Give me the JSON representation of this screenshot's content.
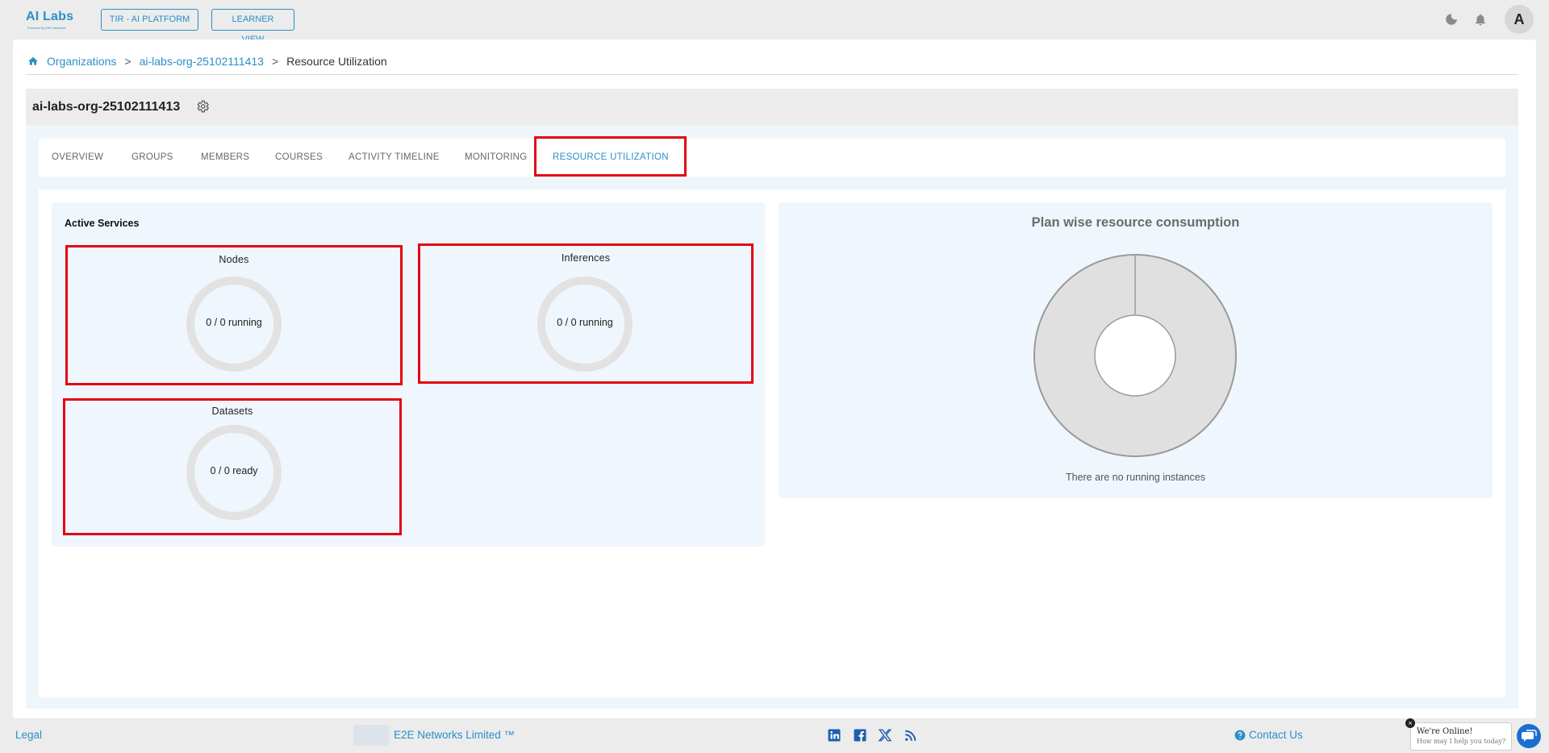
{
  "header": {
    "logo_text": "AI Labs",
    "logo_subtitle": "Powered by E2E Networks",
    "buttons": [
      "TIR - AI PLATFORM",
      "LEARNER VIEW"
    ],
    "avatar_initial": "A"
  },
  "breadcrumb": {
    "items": [
      "Organizations",
      "ai-labs-org-25102111413",
      "Resource Utilization"
    ],
    "separator": ">"
  },
  "org": {
    "title": "ai-labs-org-25102111413"
  },
  "tabs": {
    "items": [
      "OVERVIEW",
      "GROUPS",
      "MEMBERS",
      "COURSES",
      "ACTIVITY TIMELINE",
      "MONITORING",
      "RESOURCE UTILIZATION"
    ],
    "active": "RESOURCE UTILIZATION"
  },
  "active_services": {
    "title": "Active Services",
    "nodes": {
      "title": "Nodes",
      "status": "0 / 0 running"
    },
    "inferences": {
      "title": "Inferences",
      "status": "0 / 0 running"
    },
    "datasets": {
      "title": "Datasets",
      "status": "0 / 0 ready"
    }
  },
  "plan": {
    "title": "Plan wise resource consumption",
    "empty_message": "There are no running instances"
  },
  "footer": {
    "legal": "Legal",
    "company": "E2E Networks Limited ™",
    "contact": "Contact Us",
    "social_icons": [
      "linkedin-icon",
      "facebook-icon",
      "x-icon",
      "rss-icon"
    ]
  },
  "chat": {
    "title": "We're Online!",
    "subtitle": "How may I help you today?"
  },
  "colors": {
    "accent": "#2a8fc9",
    "highlight": "#e30613",
    "panel": "#eff6fd"
  }
}
